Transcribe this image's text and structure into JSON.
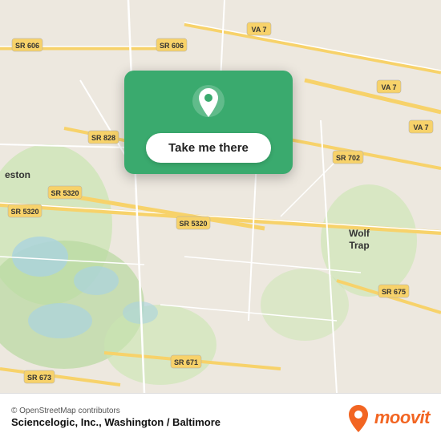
{
  "map": {
    "attribution": "© OpenStreetMap contributors",
    "location_name": "Sciencelogic, Inc., Washington / Baltimore",
    "popup": {
      "button_label": "Take me there",
      "pin_icon": "location-pin-icon"
    }
  },
  "moovit": {
    "brand": "moovit",
    "logo_icon": "moovit-logo-icon"
  },
  "colors": {
    "popup_bg": "#3aaa6e",
    "road_yellow": "#f7d26a",
    "road_white": "#ffffff",
    "map_bg": "#e8e0d8",
    "water": "#aad3df",
    "green_area": "#c8e6c0",
    "moovit_orange": "#f26522"
  }
}
